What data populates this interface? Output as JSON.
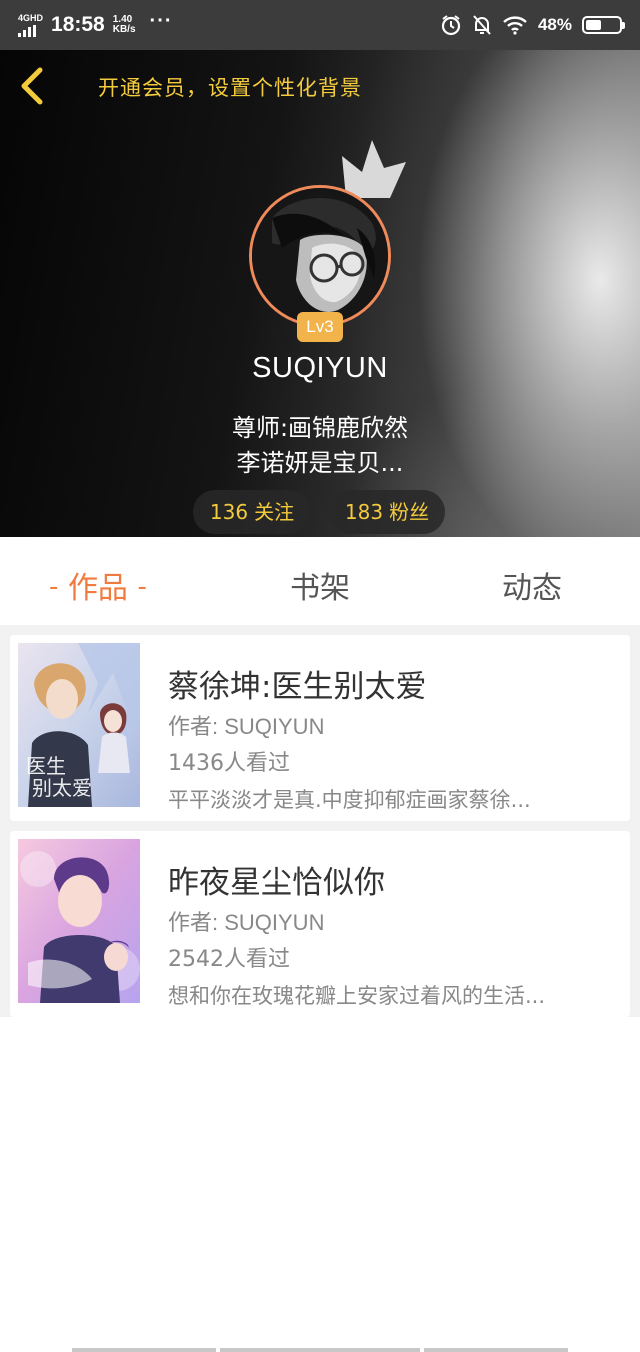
{
  "status_bar": {
    "network": "4GHD",
    "time": "18:58",
    "speed_value": "1.40",
    "speed_unit": "KB/s",
    "more": "···",
    "battery": "48%",
    "battery_level": 0.48,
    "icons": [
      "alarm-icon",
      "bell-off-icon",
      "wifi-icon",
      "battery-icon"
    ]
  },
  "header": {
    "back_icon": "chevron-left-icon",
    "vip_link": "开通会员，设置个性化背景",
    "level": "Lv3",
    "username": "SUQIYUN",
    "bio_line1": "尊师:画锦鹿欣然",
    "bio_line2": "李诺妍是宝贝...",
    "following_count": "136",
    "following_label": "关注",
    "fans_count": "183",
    "fans_label": "粉丝",
    "accent_color": "#f3cb3c"
  },
  "tabs": {
    "works": "作品",
    "shelf": "书架",
    "feed": "动态",
    "active": "works",
    "active_color": "#f07b3f"
  },
  "books": [
    {
      "title": "蔡徐坤:医生别太爱",
      "author": "作者: SUQIYUN",
      "views": "1436人看过",
      "description": "平平淡淡才是真.中度抑郁症画家蔡徐...",
      "cover_text": "医生别太爱"
    },
    {
      "title": "昨夜星尘恰似你",
      "author": "作者: SUQIYUN",
      "views": "2542人看过",
      "description": "想和你在玫瑰花瓣上安家过着风的生活..."
    }
  ]
}
